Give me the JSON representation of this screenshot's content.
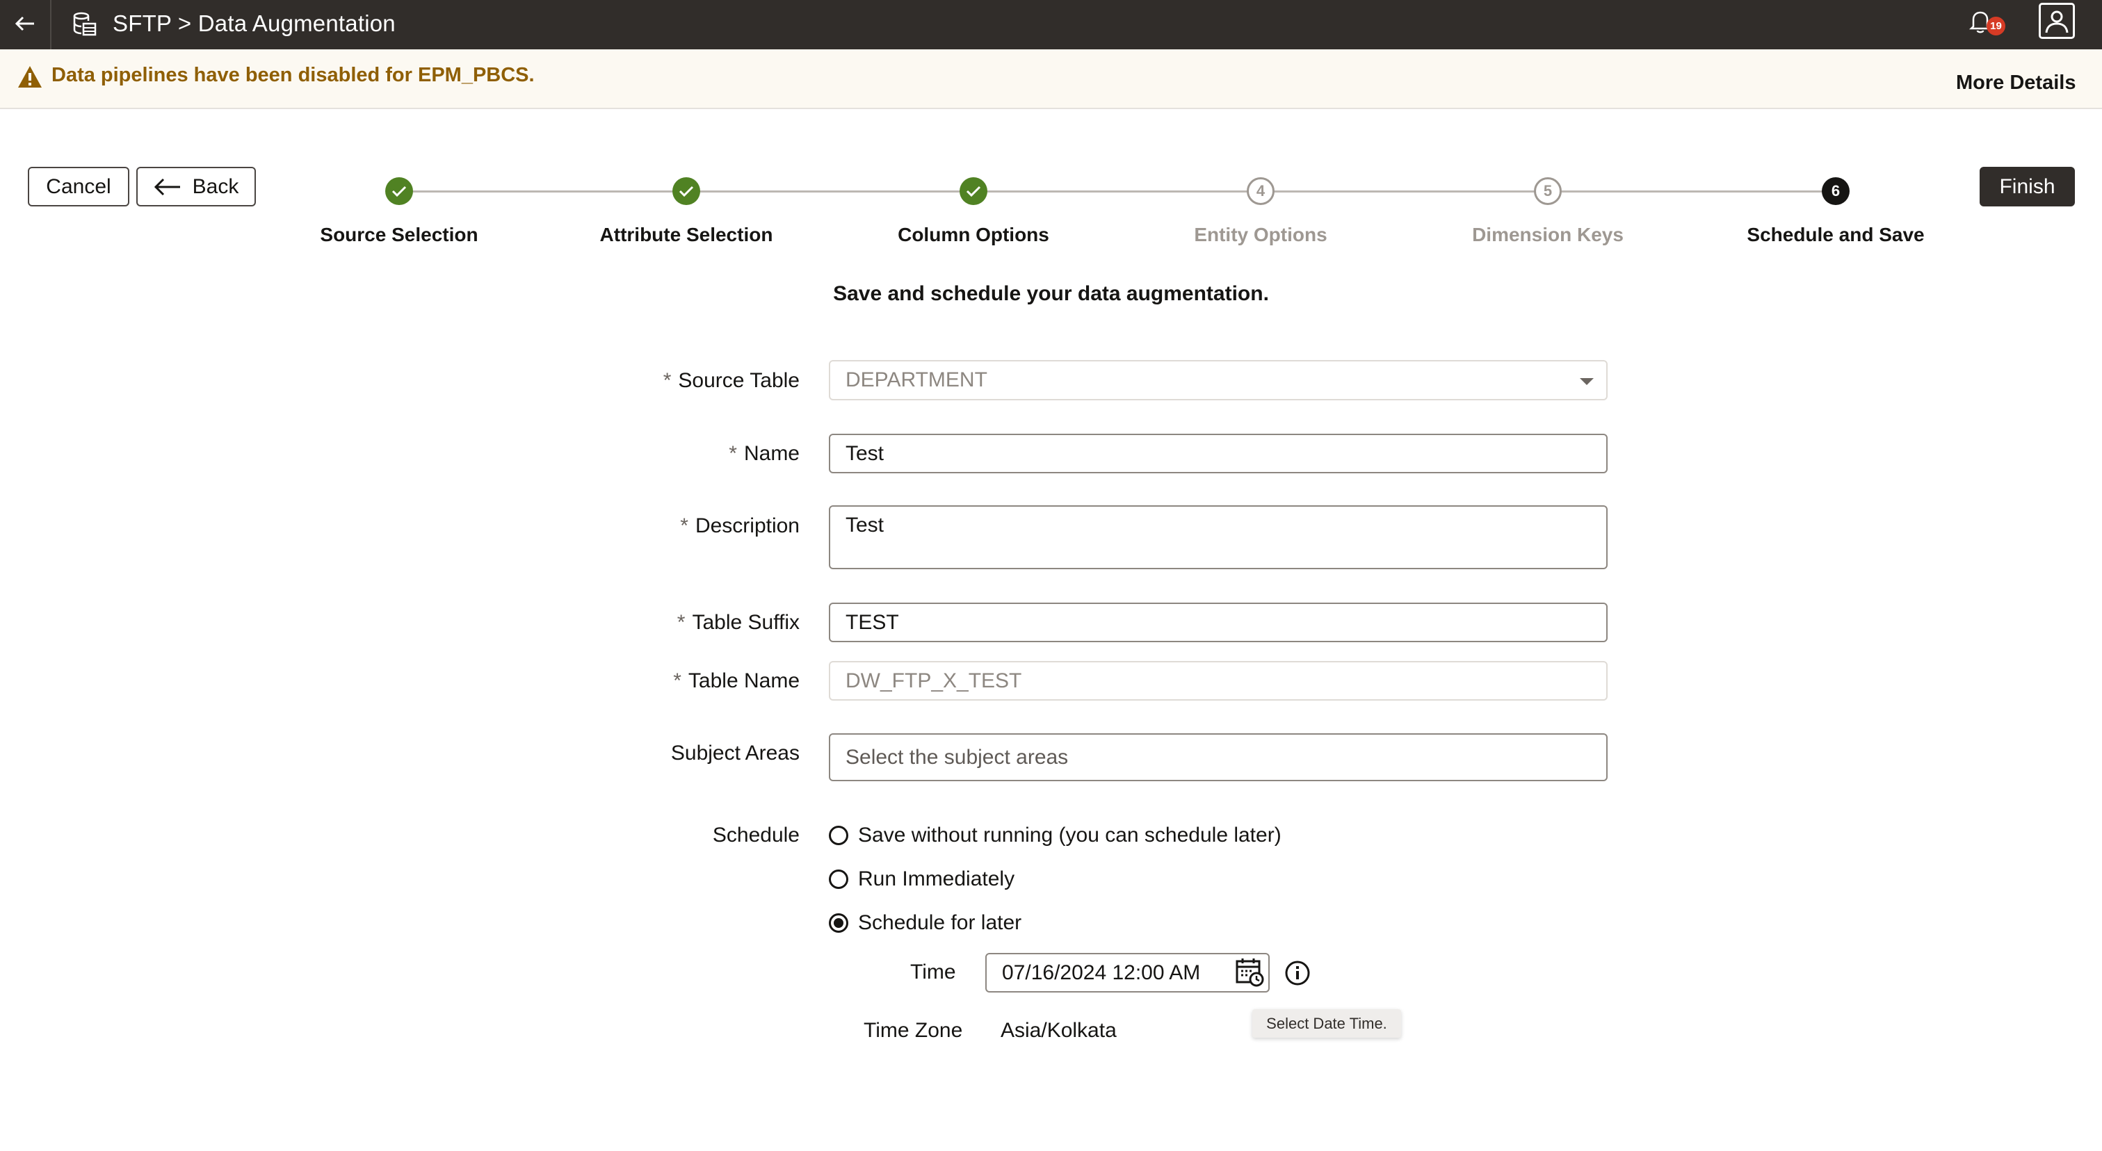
{
  "header": {
    "title": "SFTP > Data Augmentation",
    "notification_count": "19",
    "icons": [
      "back-arrow-icon",
      "database-icon",
      "bell-icon",
      "user-avatar-icon"
    ]
  },
  "banner": {
    "message": "Data pipelines have been disabled for EPM_PBCS.",
    "more_details": "More Details",
    "color": "#8f5f05"
  },
  "actions": {
    "cancel": "Cancel",
    "back": "Back",
    "finish": "Finish"
  },
  "steps": [
    {
      "label": "Source Selection",
      "state": "done"
    },
    {
      "label": "Attribute Selection",
      "state": "done"
    },
    {
      "label": "Column Options",
      "state": "done"
    },
    {
      "label": "Entity Options",
      "state": "pending",
      "number": "4"
    },
    {
      "label": "Dimension Keys",
      "state": "pending",
      "number": "5"
    },
    {
      "label": "Schedule and Save",
      "state": "current",
      "number": "6"
    }
  ],
  "subtitle": "Save and schedule your data augmentation.",
  "form": {
    "source_table": {
      "label": "Source Table",
      "value": "DEPARTMENT"
    },
    "name": {
      "label": "Name",
      "value": "Test"
    },
    "description": {
      "label": "Description",
      "value": "Test"
    },
    "table_suffix": {
      "label": "Table Suffix",
      "value": "TEST"
    },
    "table_name": {
      "label": "Table Name",
      "value": "DW_FTP_X_TEST"
    },
    "subject_areas": {
      "label": "Subject Areas",
      "placeholder": "Select the subject areas"
    },
    "schedule": {
      "label": "Schedule",
      "options": [
        "Save without running (you can schedule later)",
        "Run Immediately",
        "Schedule for later"
      ],
      "selected": "Schedule for later"
    },
    "time": {
      "label": "Time",
      "value": "07/16/2024 12:00 AM",
      "tooltip": "Select Date Time."
    },
    "timezone": {
      "label": "Time Zone",
      "value": "Asia/Kolkata"
    }
  }
}
